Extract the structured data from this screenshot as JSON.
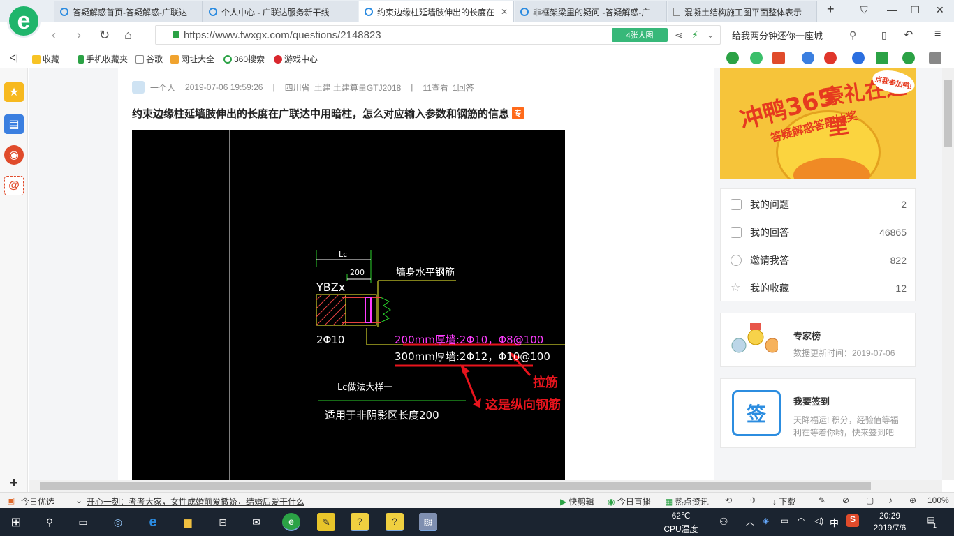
{
  "browser": {
    "tabs": [
      {
        "label": "答疑解惑首页-答疑解惑-广联达",
        "active": false
      },
      {
        "label": "个人中心 - 广联达服务新干线",
        "active": false
      },
      {
        "label": "约束边缘柱延墙肢伸出的长度在",
        "active": true
      },
      {
        "label": "非框架梁里的疑问 -答疑解惑-广",
        "active": false
      },
      {
        "label": "混凝土结构施工图平面整体表示",
        "active": false
      }
    ],
    "url": "https://www.fwxgx.com/questions/2148823",
    "pic_button": "4张大图",
    "search_text": "给我两分钟还你一座城",
    "bookmarks": [
      "收藏",
      "手机收藏夹",
      "谷歌",
      "网址大全",
      "360搜索",
      "游戏中心"
    ]
  },
  "question": {
    "author": "一个人",
    "datetime": "2019-07-06 19:59:26",
    "region": "四川省",
    "category": "土建 土建算量GTJ2018",
    "views": "11查看",
    "answers": "1回答",
    "title": "约束边缘柱延墙肢伸出的长度在广联达中用暗柱，怎么对应输入参数和钢筋的信息",
    "badge": "专"
  },
  "drawing": {
    "lc_label": "Lc",
    "dim_200": "200",
    "wall_rebar": "墙身水平钢筋",
    "column_name": "YBZx",
    "rebar_2phi10": "2Φ10",
    "line_200mm": "200mm厚墙:2Φ10，Φ8@100",
    "line_300mm": "300mm厚墙:2Φ12，Φ10@100",
    "lc_detail": "Lc做法大样一",
    "applicable": "适用于非阴影区长度200",
    "note_tie": "拉筋",
    "note_longitudinal": "这是纵向钢筋"
  },
  "banner": {
    "text1": "冲鸭365",
    "text2": "豪礼在这里",
    "text3": "答疑解惑答题抽奖",
    "text4": "点我参加鸭!"
  },
  "stats": [
    {
      "label": "我的问题",
      "count": "2",
      "icon": "question-icon"
    },
    {
      "label": "我的回答",
      "count": "46865",
      "icon": "comment-icon"
    },
    {
      "label": "邀请我答",
      "count": "822",
      "icon": "user-plus-icon"
    },
    {
      "label": "我的收藏",
      "count": "12",
      "icon": "star-icon"
    }
  ],
  "expert": {
    "title": "专家榜",
    "updated": "数据更新时间：2019-07-06"
  },
  "signin": {
    "title": "我要签到",
    "icon_text": "签",
    "desc": "天降福运! 积分，经验值等福利在等着你哟，快来签到吧"
  },
  "statusbar": {
    "today": "今日优选",
    "headline": "开心一刻：考考大家，女性成婚前爱撒娇，结婚后爱干什么",
    "items": [
      "快剪辑",
      "今日直播",
      "热点资讯",
      "下载"
    ],
    "zoom": "100%"
  },
  "taskbar": {
    "temp": "62℃",
    "temp_label": "CPU温度",
    "ime": "中",
    "time": "20:29",
    "date": "2019/7/6",
    "notif": "1"
  },
  "colors": {
    "accent_green": "#1fb56b",
    "cad_magenta": "#ff3cff",
    "cad_green": "#2bd42b",
    "cad_yellow": "#ffff33",
    "annotation_red": "#e8141d"
  }
}
